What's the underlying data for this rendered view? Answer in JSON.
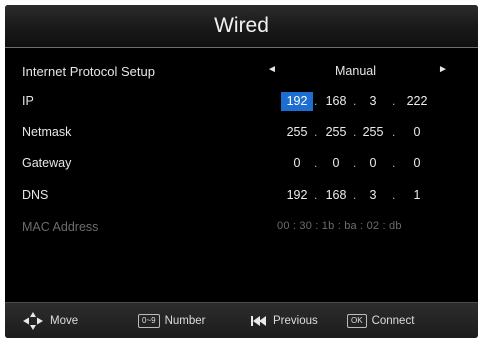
{
  "window": {
    "title": "Wired"
  },
  "protocol": {
    "label": "Internet Protocol Setup",
    "value": "Manual",
    "left_arrow": "◄",
    "right_arrow": "►"
  },
  "fields": {
    "ip": {
      "label": "IP",
      "octets": [
        "192",
        "168",
        "3",
        "222"
      ],
      "selected_octet_index": 0
    },
    "netmask": {
      "label": "Netmask",
      "octets": [
        "255",
        "255",
        "255",
        "0"
      ]
    },
    "gateway": {
      "label": "Gateway",
      "octets": [
        "0",
        "0",
        "0",
        "0"
      ]
    },
    "dns": {
      "label": "DNS",
      "octets": [
        "192",
        "168",
        "3",
        "1"
      ]
    }
  },
  "separator": ".",
  "mac": {
    "label": "MAC Address",
    "value": "00 : 30 : 1b : ba : 02 : db"
  },
  "footer": {
    "move_label": "Move",
    "number_key": "0~9",
    "number_label": "Number",
    "previous_label": "Previous",
    "ok_key": "OK",
    "connect_label": "Connect"
  },
  "icons": {
    "move": "four-way-arrow-icon",
    "number": "number-key-icon",
    "previous": "skip-previous-icon",
    "ok": "ok-key-icon"
  },
  "colors": {
    "background": "#000000",
    "selection": "#1c6fd1",
    "text": "#e6e6e6",
    "disabled_text": "#6c6c6c"
  }
}
